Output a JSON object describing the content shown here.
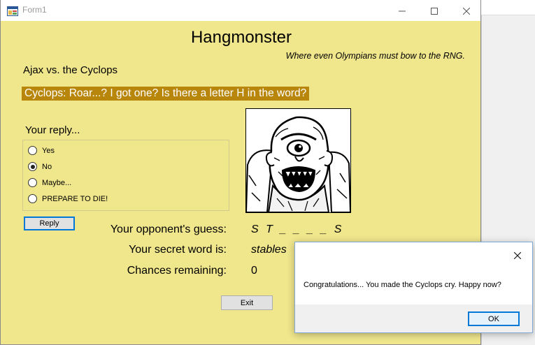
{
  "window": {
    "title": "Form1",
    "icon": "winforms-app-icon"
  },
  "header": {
    "title": "Hangmonster",
    "subtitle": "Where even Olympians must bow to the RNG."
  },
  "match_label": "Ajax vs. the Cyclops",
  "monster_speech": "Cyclops: Roar...? I got one? Is there a letter H in the word?",
  "reply": {
    "label": "Your reply...",
    "options": [
      {
        "label": "Yes",
        "selected": false
      },
      {
        "label": "No",
        "selected": true
      },
      {
        "label": "Maybe...",
        "selected": false
      },
      {
        "label": "PREPARE TO DIE!",
        "selected": false
      }
    ],
    "button_label": "Reply"
  },
  "stats": {
    "opponent_guess_label": "Your opponent's guess:",
    "opponent_guess_value": "S T _ _ _ _ S",
    "secret_word_label": "Your secret word is:",
    "secret_word_value": "stables",
    "chances_label": "Chances remaining:",
    "chances_value": "0"
  },
  "exit_button_label": "Exit",
  "portrait_icon": "cyclops-portrait",
  "message_box": {
    "text": "Congratulations... You made the Cyclops cry. Happy now?",
    "ok_label": "OK"
  },
  "colors": {
    "form_background": "#f0e68c",
    "speech_background": "#b8860b",
    "speech_text": "#ffffff",
    "focus_border": "#0078d7"
  }
}
